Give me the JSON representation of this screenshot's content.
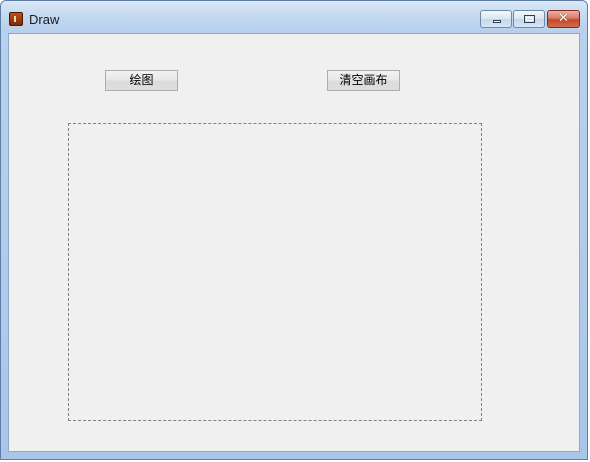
{
  "window": {
    "title": "Draw"
  },
  "toolbar": {
    "draw_label": "绘图",
    "clear_label": "清空画布"
  },
  "colors": {
    "client_background": "#f0f0f0",
    "canvas_border": "#808080",
    "close_button": "#c6462a"
  }
}
